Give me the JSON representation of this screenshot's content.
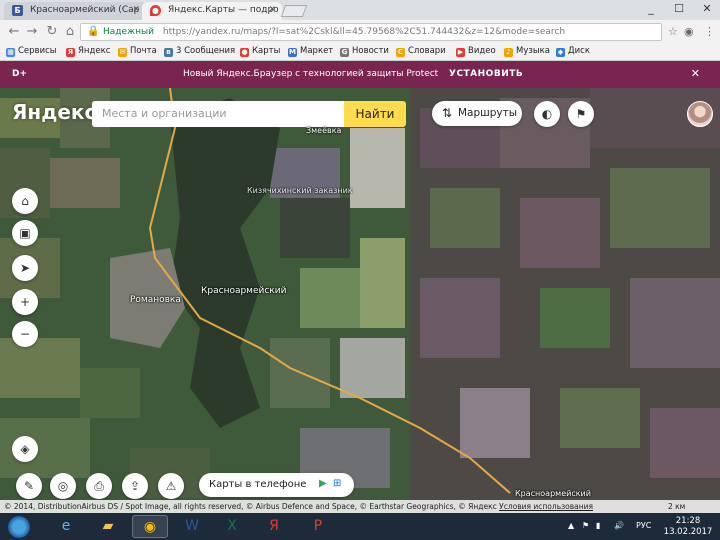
{
  "tabs": [
    {
      "label": "Красноармейский (Сар",
      "favicon": "yandex-b-icon",
      "color": "#3b5998",
      "active": false
    },
    {
      "label": "Яндекс.Карты — подро",
      "favicon": "yandex-maps-pin-icon",
      "color": "#e53935",
      "active": true
    }
  ],
  "window_controls": [
    "_",
    "☐",
    "✕"
  ],
  "address": {
    "secure_label": "Надежный",
    "url": "https://yandex.ru/maps/?l=sat%2Cskl&ll=45.79568%2C51.744432&z=12&mode=search"
  },
  "bookmarks": [
    {
      "label": "Сервисы",
      "color": "#4285f4"
    },
    {
      "label": "Яндекс",
      "color": "#e53935"
    },
    {
      "label": "Почта",
      "color": "#f4a300"
    },
    {
      "label": "3 Сообщения",
      "color": "#4a76a8"
    },
    {
      "label": "Карты",
      "color": "#e53935"
    },
    {
      "label": "Маркет",
      "color": "#3a6fd8"
    },
    {
      "label": "Новости",
      "color": "#777777"
    },
    {
      "label": "Словари",
      "color": "#f4a300"
    },
    {
      "label": "Видео",
      "color": "#e53935"
    },
    {
      "label": "Музыка",
      "color": "#f4a300"
    },
    {
      "label": "Диск",
      "color": "#2f7ce0"
    }
  ],
  "promo": {
    "brand": "D+",
    "text": "Новый Яндекс.Браузер с технологией защиты Protect",
    "cta": "УСТАНОВИТЬ"
  },
  "map": {
    "logo": "Яндекс",
    "search_placeholder": "Места и организации",
    "find_label": "Найти",
    "routes_label": "Маршруты",
    "labels": {
      "romanovka": "Романовка",
      "krasnoarmeysky": "Красноармейский",
      "forest": "Кизячихинский заказник",
      "top": "Змеёвка",
      "bottom": "Красноармейский"
    },
    "phone_promo": "Карты в телефоне",
    "copyright": "© 2014, DistributionAirbus DS / Spot Image, all rights reserved, © Airbus Defence and Space, © Earthstar Geographics, © Яндекс",
    "conditions": "Условия использования",
    "scale": "2 км"
  },
  "taskbar": {
    "lang": "РУС",
    "time": "21:28",
    "date": "13.02.2017"
  }
}
